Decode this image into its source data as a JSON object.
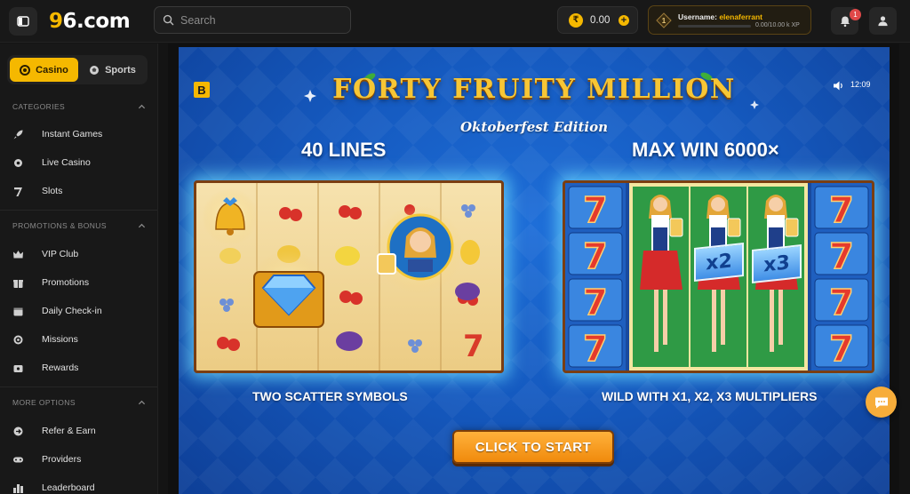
{
  "header": {
    "logo_text_a": "9",
    "logo_text_b": "6.com",
    "search_placeholder": "Search",
    "balance": "0.00",
    "coin_symbol": "₹",
    "user_label": "Username:",
    "username": "elenaferrant",
    "level": "1",
    "xp": "0.00/10.00 k XP",
    "notification_count": "1"
  },
  "sidebar": {
    "modes": [
      {
        "label": "Casino",
        "icon": "casino-chip-icon",
        "active": true
      },
      {
        "label": "Sports",
        "icon": "sports-ball-icon",
        "active": false
      }
    ],
    "sections": [
      {
        "title": "CATEGORIES",
        "items": [
          {
            "label": "Instant Games",
            "icon": "rocket-icon"
          },
          {
            "label": "Live Casino",
            "icon": "live-casino-icon"
          },
          {
            "label": "Slots",
            "icon": "slot-seven-icon"
          }
        ]
      },
      {
        "title": "PROMOTIONS & BONUS",
        "items": [
          {
            "label": "VIP Club",
            "icon": "crown-icon"
          },
          {
            "label": "Promotions",
            "icon": "gift-icon"
          },
          {
            "label": "Daily Check-in",
            "icon": "calendar-icon"
          },
          {
            "label": "Missions",
            "icon": "target-icon"
          },
          {
            "label": "Rewards",
            "icon": "reward-icon"
          }
        ]
      },
      {
        "title": "MORE OPTIONS",
        "items": [
          {
            "label": "Refer & Earn",
            "icon": "refer-icon"
          },
          {
            "label": "Providers",
            "icon": "providers-icon"
          },
          {
            "label": "Leaderboard",
            "icon": "leaderboard-icon"
          }
        ]
      }
    ]
  },
  "game": {
    "provider_badge": "B",
    "clock": "12:09",
    "title": "FORTY FRUITY MILLION",
    "subtitle": "Oktoberfest Edition",
    "left_heading": "40 LINES",
    "right_heading": "MAX WIN 6000×",
    "left_caption": "TWO SCATTER SYMBOLS",
    "right_caption": "WILD WITH X1, X2, X3 MULTIPLIERS",
    "multipliers": [
      "x2",
      "x3"
    ],
    "start_label": "CLICK TO START"
  }
}
